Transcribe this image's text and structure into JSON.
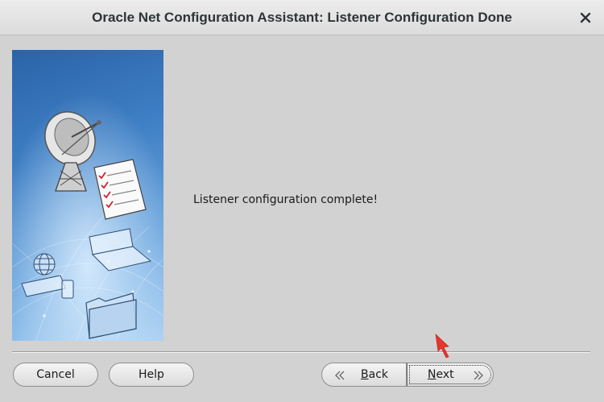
{
  "window": {
    "title": "Oracle Net Configuration Assistant: Listener Configuration Done"
  },
  "content": {
    "message": "Listener configuration complete!"
  },
  "buttons": {
    "cancel": "Cancel",
    "help": "Help",
    "back_mnemonic": "B",
    "back_rest": "ack",
    "next_mnemonic": "N",
    "next_rest": "ext"
  },
  "icons": {
    "close": "close-icon",
    "back": "chevron-left-double-icon",
    "next": "chevron-right-double-icon"
  },
  "colors": {
    "panel_blue": "#3f7fc4",
    "cursor_red": "#e8352b"
  }
}
